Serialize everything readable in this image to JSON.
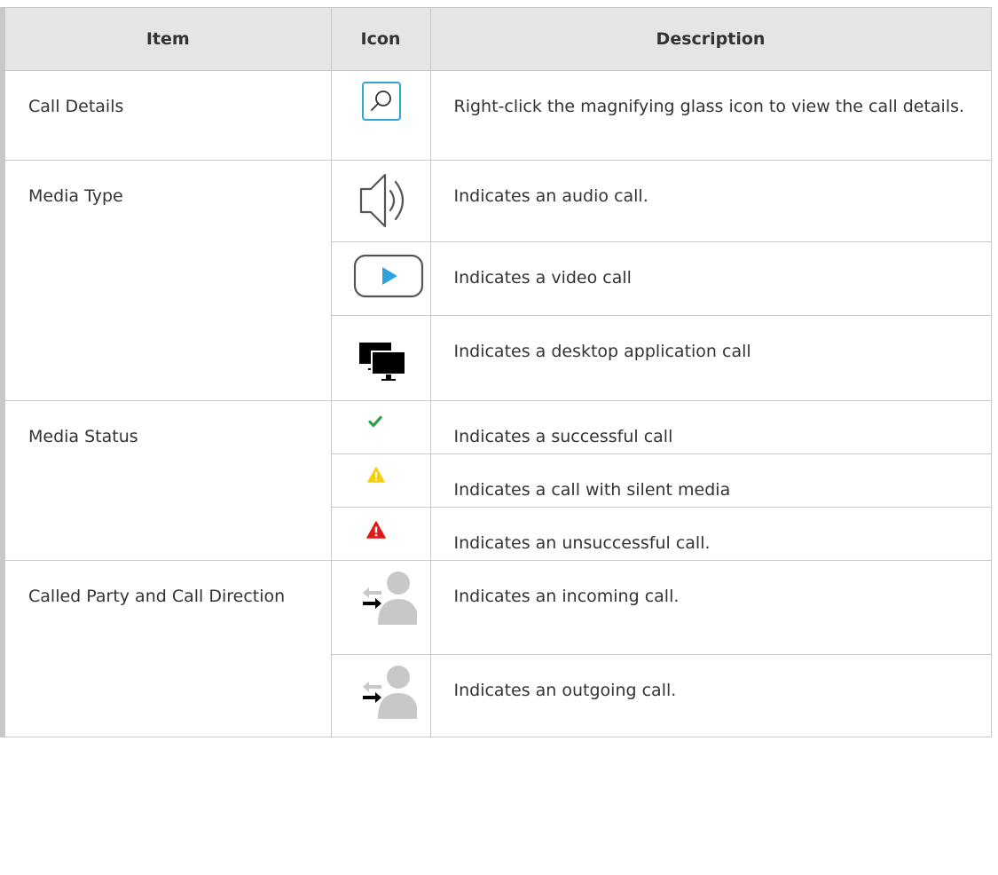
{
  "columns": {
    "item": "Item",
    "icon": "Icon",
    "description": "Description"
  },
  "rows": [
    {
      "item": "Call Details",
      "icon": "magnifying-glass-icon",
      "description": "Right-click the magnifying glass icon to view the call details."
    },
    {
      "item": "Media Type",
      "icon": "speaker-audio-icon",
      "description": "Indicates an audio call."
    },
    {
      "item": "",
      "icon": "video-play-icon",
      "description": "Indicates a video call"
    },
    {
      "item": "",
      "icon": "desktop-monitors-icon",
      "description": "Indicates a desktop application call"
    },
    {
      "item": "Media Status",
      "icon": "checkmark-icon",
      "description": "Indicates a successful call"
    },
    {
      "item": "",
      "icon": "warning-yellow-icon",
      "description": "Indicates a call with silent media"
    },
    {
      "item": "",
      "icon": "warning-red-icon",
      "description": "Indicates an unsuccessful call."
    },
    {
      "item": "Called Party and Call Direction",
      "icon": "incoming-call-person-icon",
      "description": "Indicates an incoming call."
    },
    {
      "item": "",
      "icon": "outgoing-call-person-icon",
      "description": "Indicates an outgoing call."
    }
  ],
  "colors": {
    "header_bg": "#e5e5e5",
    "border": "#c8c8c8",
    "accent_blue": "#2fa3dc",
    "success_green": "#2ca14a",
    "warning_yellow": "#f5cf0a",
    "error_red": "#e01919"
  }
}
